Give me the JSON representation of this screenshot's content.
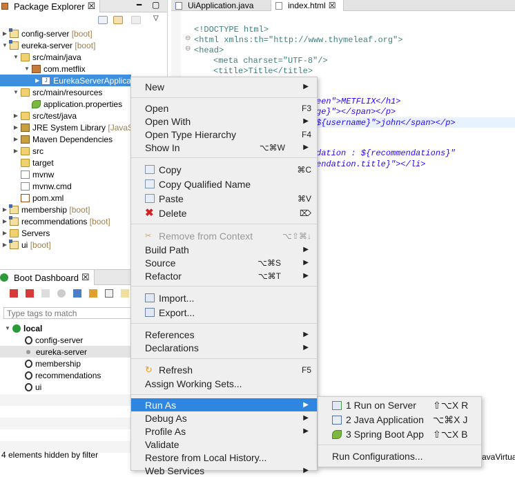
{
  "package_explorer": {
    "title": "Package Explorer",
    "tree": [
      {
        "label": "config-server",
        "tag": "[boot]"
      },
      {
        "label": "eureka-server",
        "tag": "[boot]"
      },
      {
        "label": "src/main/java",
        "tag": ""
      },
      {
        "label": "com.metflix",
        "tag": ""
      },
      {
        "label": "EurekaServerApplica",
        "tag": ""
      },
      {
        "label": "src/main/resources",
        "tag": ""
      },
      {
        "label": "application.properties",
        "tag": ""
      },
      {
        "label": "src/test/java",
        "tag": ""
      },
      {
        "label": "JRE System Library",
        "tag": "[JavaS"
      },
      {
        "label": "Maven Dependencies",
        "tag": ""
      },
      {
        "label": "src",
        "tag": ""
      },
      {
        "label": "target",
        "tag": ""
      },
      {
        "label": "mvnw",
        "tag": ""
      },
      {
        "label": "mvnw.cmd",
        "tag": ""
      },
      {
        "label": "pom.xml",
        "tag": ""
      },
      {
        "label": "membership",
        "tag": "[boot]"
      },
      {
        "label": "recommendations",
        "tag": "[boot]"
      },
      {
        "label": "Servers",
        "tag": ""
      },
      {
        "label": "ui",
        "tag": "[boot]"
      }
    ]
  },
  "boot_dashboard": {
    "title": "Boot Dashboard",
    "filter_placeholder": "Type tags to match",
    "group": "local",
    "apps": [
      "config-server",
      "eureka-server",
      "membership",
      "recommendations",
      "ui"
    ],
    "footer": "4 elements hidden by filter"
  },
  "editor": {
    "tabs": [
      "UiApplication.java",
      "index.html"
    ],
    "lines": [
      "<!DOCTYPE html>",
      "<html xmlns:th=\"http://www.thymeleaf.org\">",
      "<head>",
      "<meta charset=\"UTF-8\"/>",
      "<title>Title</title>",
      "een\">METFLIX</h1>",
      "ge}\"></span></p>",
      "${username}\">john</span></p>",
      "dation : ${recommendations}\"",
      "endation.title}\"></li>",
      "avaVirtual"
    ]
  },
  "context_menu": {
    "items": [
      {
        "label": "New",
        "shortcut": "",
        "arrow": true
      },
      {
        "label": "Open",
        "shortcut": "F3",
        "arrow": false
      },
      {
        "label": "Open With",
        "shortcut": "",
        "arrow": true
      },
      {
        "label": "Open Type Hierarchy",
        "shortcut": "F4",
        "arrow": false
      },
      {
        "label": "Show In",
        "shortcut": "⌥⌘W",
        "arrow": true
      },
      {
        "label": "Copy",
        "shortcut": "⌘C",
        "arrow": false
      },
      {
        "label": "Copy Qualified Name",
        "shortcut": "",
        "arrow": false
      },
      {
        "label": "Paste",
        "shortcut": "⌘V",
        "arrow": false
      },
      {
        "label": "Delete",
        "shortcut": "⌦",
        "arrow": false
      },
      {
        "label": "Remove from Context",
        "shortcut": "⌥⇧⌘↓",
        "arrow": false
      },
      {
        "label": "Build Path",
        "shortcut": "",
        "arrow": true
      },
      {
        "label": "Source",
        "shortcut": "⌥⌘S",
        "arrow": true
      },
      {
        "label": "Refactor",
        "shortcut": "⌥⌘T",
        "arrow": true
      },
      {
        "label": "Import...",
        "shortcut": "",
        "arrow": false
      },
      {
        "label": "Export...",
        "shortcut": "",
        "arrow": false
      },
      {
        "label": "References",
        "shortcut": "",
        "arrow": true
      },
      {
        "label": "Declarations",
        "shortcut": "",
        "arrow": true
      },
      {
        "label": "Refresh",
        "shortcut": "F5",
        "arrow": false
      },
      {
        "label": "Assign Working Sets...",
        "shortcut": "",
        "arrow": false
      },
      {
        "label": "Run As",
        "shortcut": "",
        "arrow": true
      },
      {
        "label": "Debug As",
        "shortcut": "",
        "arrow": true
      },
      {
        "label": "Profile As",
        "shortcut": "",
        "arrow": true
      },
      {
        "label": "Validate",
        "shortcut": "",
        "arrow": false
      },
      {
        "label": "Restore from Local History...",
        "shortcut": "",
        "arrow": false
      },
      {
        "label": "Web Services",
        "shortcut": "",
        "arrow": true
      }
    ]
  },
  "run_as_submenu": {
    "items": [
      {
        "label": "1 Run on Server",
        "shortcut": "⇧⌥X R"
      },
      {
        "label": "2 Java Application",
        "shortcut": "⌥⌘X J"
      },
      {
        "label": "3 Spring Boot App",
        "shortcut": "⇧⌥X B"
      },
      {
        "label": "Run Configurations...",
        "shortcut": ""
      }
    ]
  },
  "glyphs": {
    "close": "☒",
    "arrow_right": "▶",
    "arrow_down": "▼",
    "submenu": "▶"
  },
  "colors": {
    "selection": "#3d8fe0",
    "menu_highlight": "#2f86e0",
    "boot_tag": "#a08050"
  }
}
